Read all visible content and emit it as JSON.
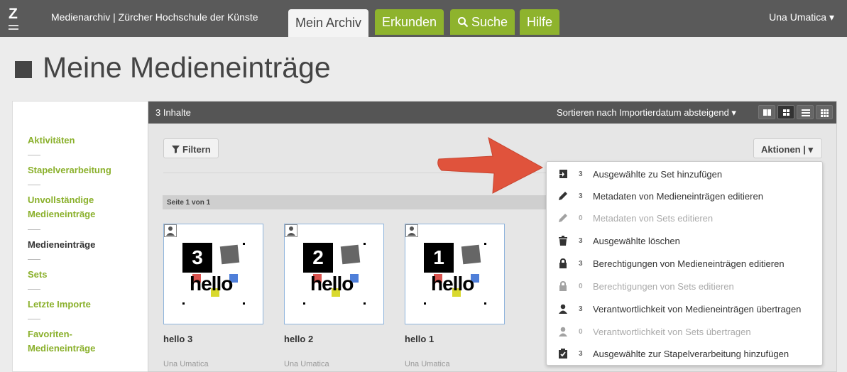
{
  "topbar": {
    "logo": "Z",
    "brand": "Medienarchiv | Zürcher Hochschule der Künste",
    "tabs": [
      "Mein Archiv",
      "Erkunden",
      "Suche",
      "Hilfe"
    ],
    "user": "Una Umatica ▾"
  },
  "page": {
    "title": "Meine Medieneinträge"
  },
  "sidebar": {
    "items": [
      {
        "label": "Aktivitäten"
      },
      {
        "label": "Stapelverarbeitung"
      },
      {
        "label": "Unvollständige"
      },
      {
        "label": "Medieneinträge"
      },
      {
        "label": "Medieneinträge"
      },
      {
        "label": "Sets"
      },
      {
        "label": "Letzte Importe"
      },
      {
        "label": "Favoriten-"
      },
      {
        "label": "Medieneinträge"
      }
    ]
  },
  "content": {
    "count": "3 Inhalte",
    "sort": "Sortieren nach Importierdatum absteigend ▾",
    "filter": "Filtern",
    "actions": "Aktionen | ▾",
    "pagebar": "Seite 1 von 1",
    "entries": [
      {
        "num": "3",
        "hello": "hello",
        "name": "hello 3",
        "author": "Una Umatica"
      },
      {
        "num": "2",
        "hello": "hello",
        "name": "hello 2",
        "author": "Una Umatica"
      },
      {
        "num": "1",
        "hello": "hello",
        "name": "hello 1",
        "author": "Una Umatica"
      }
    ]
  },
  "menu": {
    "items": [
      {
        "count": "3",
        "label": "Ausgewählte zu Set hinzufügen",
        "icon": "set-add-icon"
      },
      {
        "count": "3",
        "label": "Metadaten von Medieneinträgen editieren",
        "icon": "pencil-icon"
      },
      {
        "count": "0",
        "label": "Metadaten von Sets editieren",
        "icon": "pencil-icon"
      },
      {
        "count": "3",
        "label": "Ausgewählte löschen",
        "icon": "trash-icon"
      },
      {
        "count": "3",
        "label": "Berechtigungen von Medieneinträgen editieren",
        "icon": "lock-icon"
      },
      {
        "count": "0",
        "label": "Berechtigungen von Sets editieren",
        "icon": "lock-icon"
      },
      {
        "count": "3",
        "label": "Verantwortlichkeit von Medieneinträgen übertragen",
        "icon": "user-icon"
      },
      {
        "count": "0",
        "label": "Verantwortlichkeit von Sets übertragen",
        "icon": "user-icon"
      },
      {
        "count": "3",
        "label": "Ausgewählte zur Stapelverarbeitung hinzufügen",
        "icon": "clipboard-check-icon"
      }
    ]
  },
  "colors": {
    "accent": "#8eb32d",
    "topbar": "#5a5a5a",
    "arrow": "#e0533c"
  }
}
